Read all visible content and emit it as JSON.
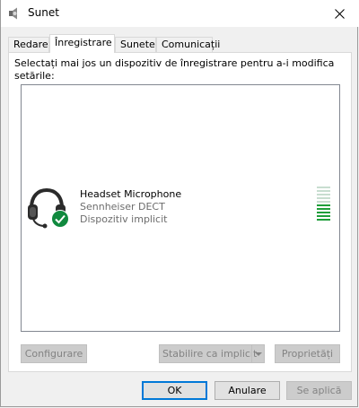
{
  "window": {
    "title": "Sunet",
    "icon": "speaker-icon",
    "close_icon": "close-icon"
  },
  "tabs": [
    {
      "label": "Redare",
      "active": false
    },
    {
      "label": "Înregistrare",
      "active": true
    },
    {
      "label": "Sunete",
      "active": false
    },
    {
      "label": "Comunicații",
      "active": false
    }
  ],
  "instructions": "Selectați mai jos un dispozitiv de înregistrare pentru a-i modifica setările:",
  "device": {
    "name": "Headset Microphone",
    "driver": "Sennheiser DECT",
    "status": "Dispozitiv implicit",
    "icon": "headset-icon",
    "badge_icon": "default-check-icon",
    "level_meter": {
      "segments": 10,
      "active_segments": 5
    }
  },
  "buttons": {
    "configure": "Configurare",
    "set_default": "Stabilire ca implicit",
    "properties": "Proprietăți",
    "ok": "OK",
    "cancel": "Anulare",
    "apply": "Se aplică"
  },
  "colors": {
    "accent": "#0078d7",
    "check_green": "#10893e",
    "meter_active": "#1f9e3a",
    "meter_inactive": "#c8ddd0"
  }
}
